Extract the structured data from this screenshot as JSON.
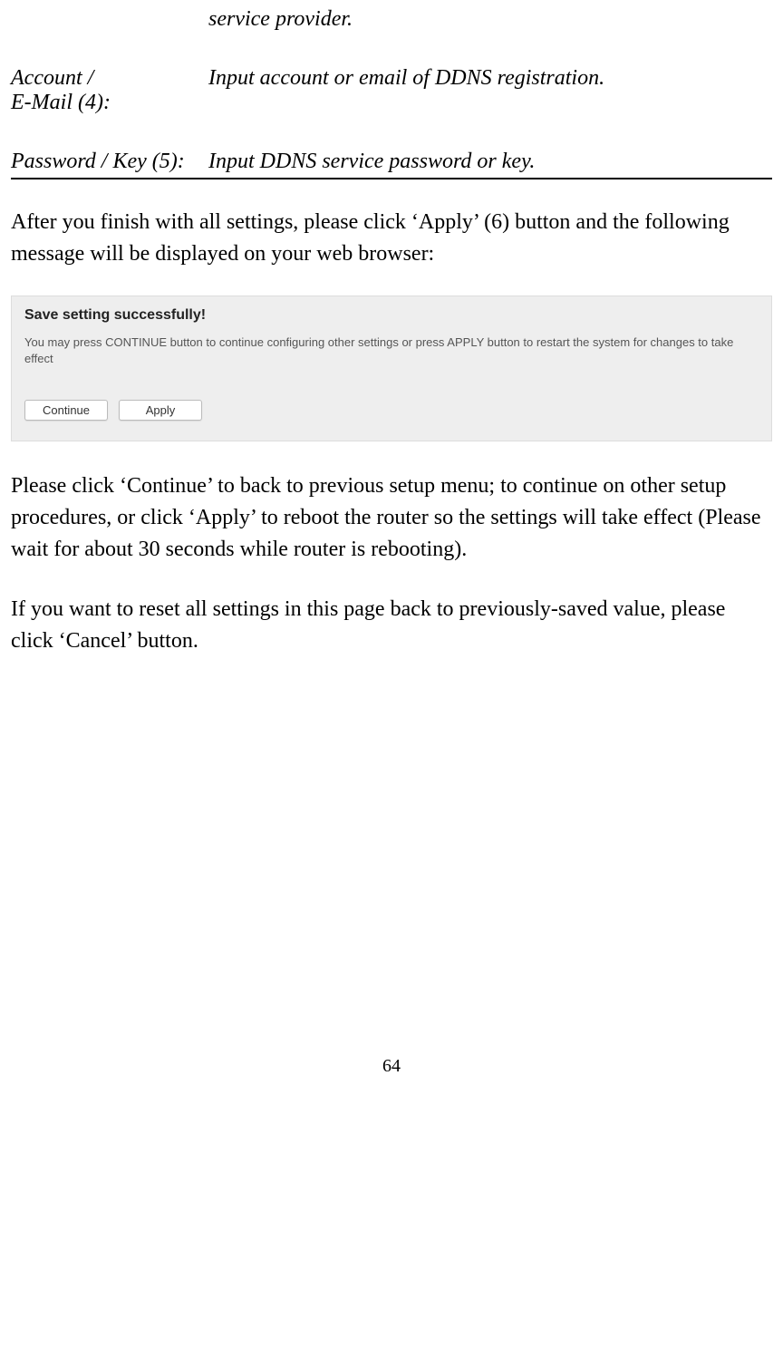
{
  "row0": {
    "label": "",
    "value": "service provider."
  },
  "row1": {
    "label_l1": "Account /",
    "label_l2": "E-Mail (4):",
    "value": "Input account or email of DDNS registration."
  },
  "row2": {
    "label": "Password / Key (5):",
    "value": "Input DDNS service password or key."
  },
  "para1": "After you finish with all settings, please click ‘Apply’ (6) button and the following message will be displayed on your web browser:",
  "screenshot": {
    "title": "Save setting successfully!",
    "subtitle": "You may press CONTINUE button to continue configuring other settings or press APPLY button to restart the system for changes to take effect",
    "continue_label": "Continue",
    "apply_label": "Apply"
  },
  "para2": "Please click ‘Continue’ to back to previous setup menu; to continue on other setup procedures, or click ‘Apply’ to reboot the router so the settings will take effect (Please wait for about 30 seconds while router is rebooting).",
  "para3": "If you want to reset all settings in this page back to previously-saved value, please click ‘Cancel’ button.",
  "pagenum": "64"
}
